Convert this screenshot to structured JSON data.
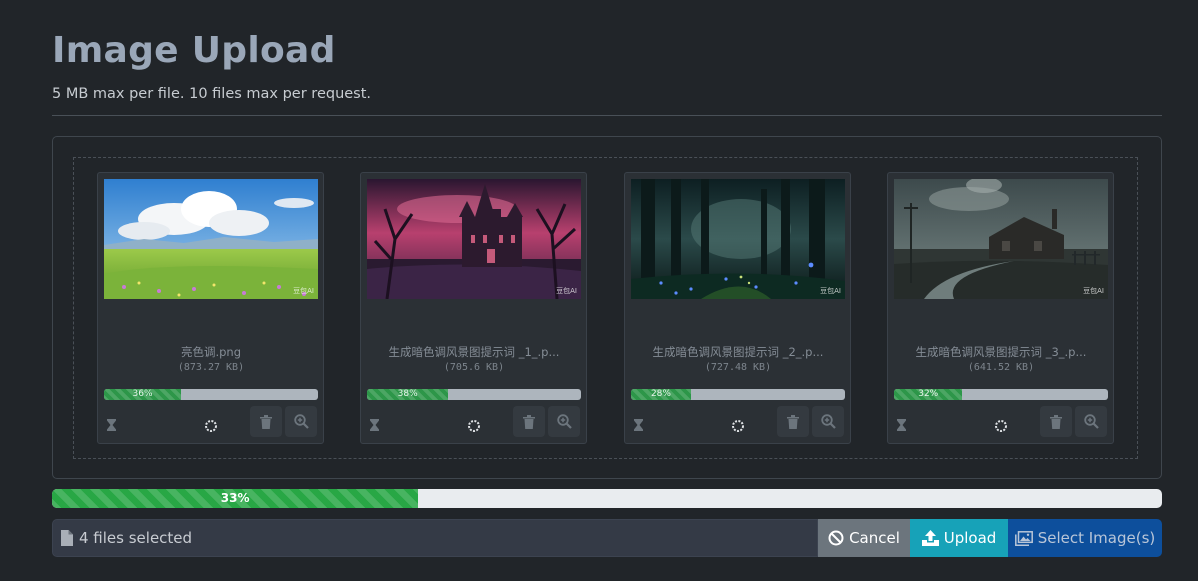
{
  "header": {
    "title": "Image Upload",
    "subtitle": "5 MB max per file. 10 files max per request."
  },
  "thumbnails": [
    {
      "name": "亮色调.png",
      "size": "(873.27 KB)",
      "progress_label": "36%",
      "progress": 36,
      "scene": "meadow",
      "watermark": "豆包AI"
    },
    {
      "name": "生成暗色调风景图提示词 _1_.p...",
      "size": "(705.6 KB)",
      "progress_label": "38%",
      "progress": 38,
      "scene": "castle",
      "watermark": "豆包AI"
    },
    {
      "name": "生成暗色调风景图提示词 _2_.p...",
      "size": "(727.48 KB)",
      "progress_label": "28%",
      "progress": 28,
      "scene": "forest",
      "watermark": "豆包AI"
    },
    {
      "name": "生成暗色调风景图提示词 _3_.p...",
      "size": "(641.52 KB)",
      "progress_label": "32%",
      "progress": 32,
      "scene": "house",
      "watermark": "豆包AI"
    }
  ],
  "overall_progress": {
    "label": "33%",
    "value": 33
  },
  "caption": {
    "text": "4 files selected",
    "icon": "file-icon"
  },
  "buttons": {
    "cancel": {
      "label": "Cancel",
      "icon": "ban-icon"
    },
    "upload": {
      "label": "Upload",
      "icon": "upload-icon"
    },
    "select": {
      "label": "Select Image(s)",
      "icon": "images-icon"
    }
  },
  "colors": {
    "background": "#212529",
    "success": "#28a745",
    "info": "#17a2b8",
    "secondary": "#6c757d",
    "primary": "#0d4f9c"
  }
}
